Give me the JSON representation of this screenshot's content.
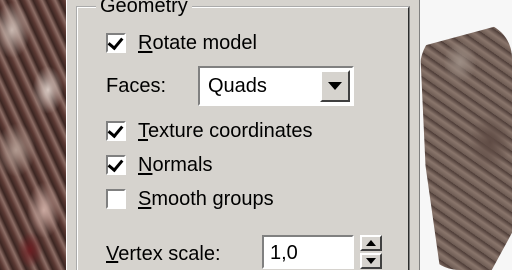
{
  "groupbox": {
    "title": "Geometry"
  },
  "options": {
    "rotate_model": {
      "label": "Rotate model",
      "mnemonic": "R",
      "checked": true
    },
    "texture_coordinates": {
      "label": "Texture coordinates",
      "mnemonic": "T",
      "checked": true
    },
    "normals": {
      "label": "Normals",
      "mnemonic": "N",
      "checked": true
    },
    "smooth_groups": {
      "label": "Smooth groups",
      "mnemonic": "S",
      "checked": false
    }
  },
  "faces": {
    "label": "Faces:",
    "selected": "Quads"
  },
  "vertex_scale": {
    "label": "Vertex scale:",
    "mnemonic": "V",
    "value": "1,0"
  },
  "colors": {
    "panel": "#d6d3ce",
    "field": "#ffffff",
    "shadow": "#808080",
    "text": "#000000"
  }
}
